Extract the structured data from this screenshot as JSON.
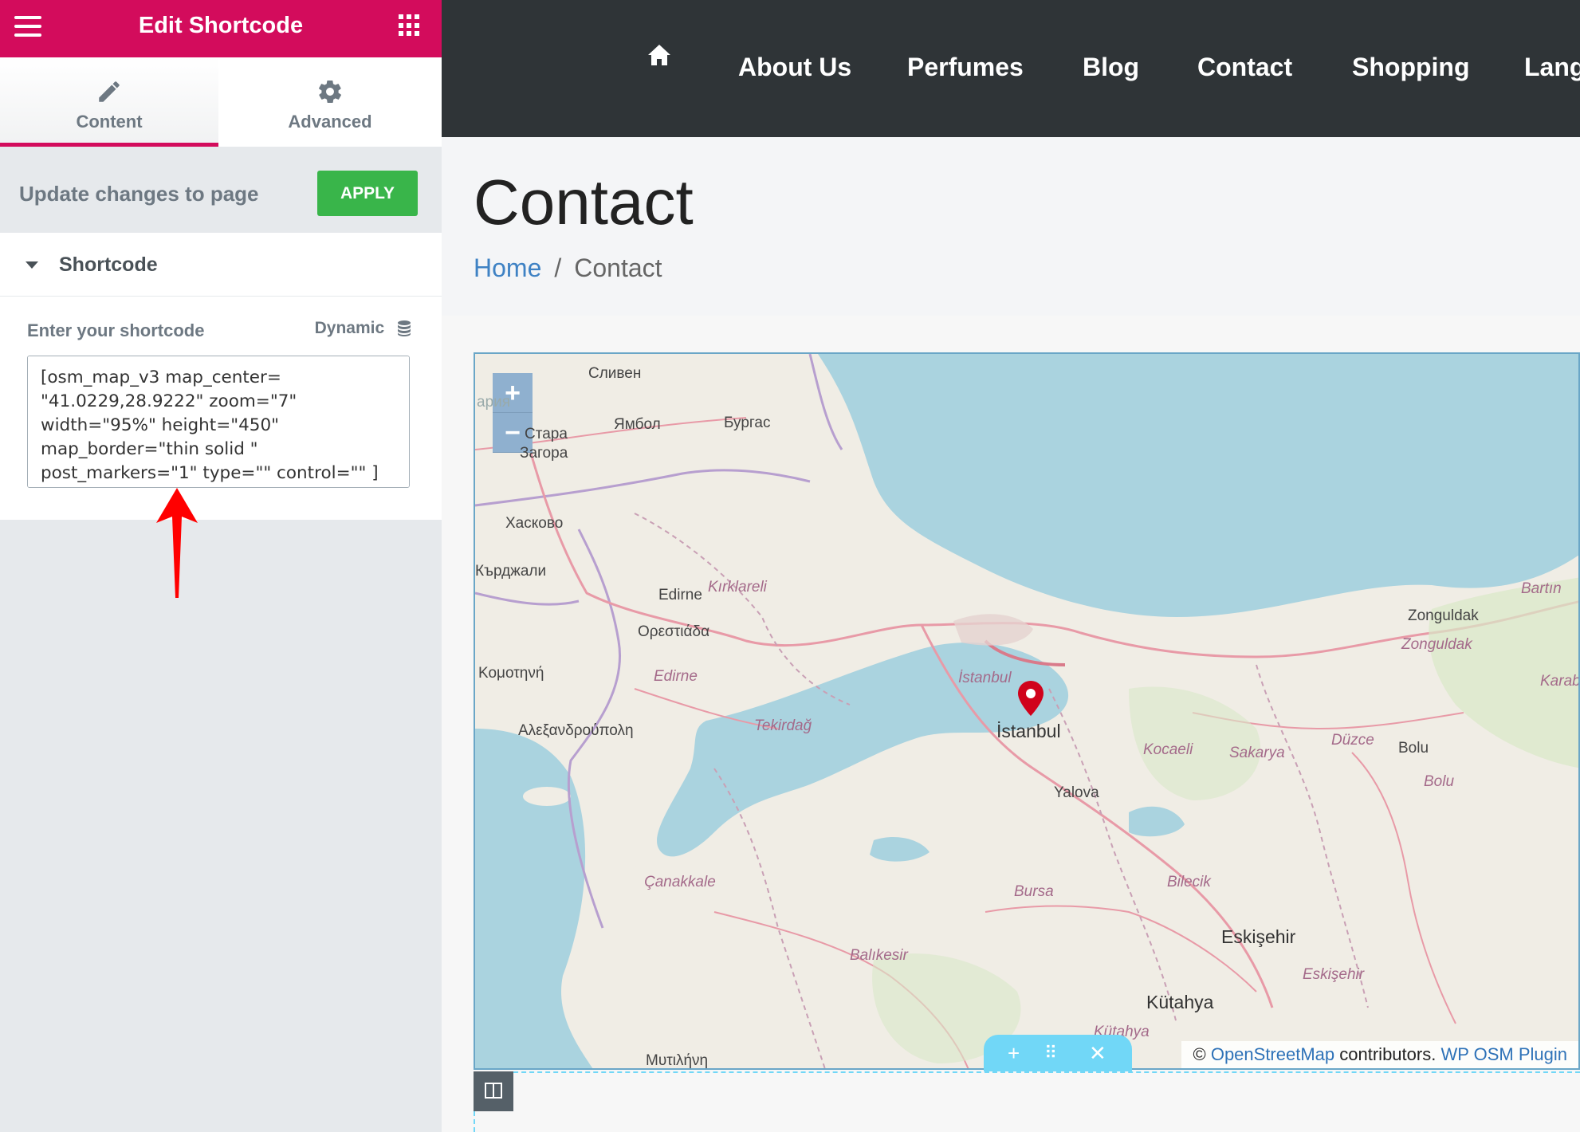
{
  "panel": {
    "header": {
      "title": "Edit Shortcode"
    },
    "tabs": [
      {
        "label": "Content",
        "icon": "pencil-icon",
        "active": true
      },
      {
        "label": "Advanced",
        "icon": "gear-icon",
        "active": false
      }
    ],
    "apply_row": {
      "label": "Update changes to page",
      "button": "APPLY"
    },
    "section": {
      "title": "Shortcode",
      "field_label": "Enter your shortcode",
      "dynamic_label": "Dynamic",
      "shortcode_value": "[osm_map_v3 map_center= \"41.0229,28.9222\" zoom=\"7\" width=\"95%\" height=\"450\" map_border=\"thin solid \" post_markers=\"1\" type=\"\" control=\"\" ]"
    },
    "colors": {
      "header": "#d30c5c",
      "apply": "#39b54a",
      "annotation_arrow": "#ff0000"
    }
  },
  "preview": {
    "nav": {
      "home_icon": "home-icon",
      "items": [
        "About Us",
        "Perfumes",
        "Blog",
        "Contact",
        "Shopping",
        "Lang"
      ]
    },
    "page_title": "Contact",
    "breadcrumb": {
      "home": "Home",
      "separator": "/",
      "current": "Contact"
    },
    "map": {
      "zoom_in": "+",
      "zoom_out": "−",
      "labels": {
        "sliven": "Сливен",
        "aria": "ария",
        "yambol": "Ямбол",
        "burgas": "Бургас",
        "stara": "Стара",
        "zagora": "Загора",
        "haskovo": "Хасково",
        "kardzhali": "Кърджали",
        "kirklareli": "Kırklareli",
        "edirne": "Edirne",
        "orestiada": "Ορεστιάδα",
        "komotini": "Κομοτηνή",
        "edirne_prov": "Edirne",
        "alexandroupoli": "Αλεξανδρούπολη",
        "tekirdag": "Tekirdağ",
        "istanbul_prov": "İstanbul",
        "istanbul": "İstanbul",
        "kocaeli": "Kocaeli",
        "sakarya": "Sakarya",
        "duzce": "Düzce",
        "bolu": "Bolu",
        "bolu_prov": "Bolu",
        "zonguldak": "Zonguldak",
        "zonguldak_prov": "Zonguldak",
        "bartin": "Bartın",
        "karab": "Karab",
        "yalova": "Yalova",
        "canakkale": "Çanakkale",
        "bursa": "Bursa",
        "bilecik": "Bilecik",
        "eskisehir": "Eskişehir",
        "eskisehir_prov": "Eskişehir",
        "balikesir": "Balıkesir",
        "kutahya": "Kütahya",
        "kutahya_prov": "Kütahya",
        "mytilini": "Μυτιλήνη"
      },
      "attribution": {
        "prefix": "©",
        "osm": "OpenStreetMap",
        "mid": "contributors.",
        "plugin": "WP OSM Plugin"
      }
    }
  }
}
